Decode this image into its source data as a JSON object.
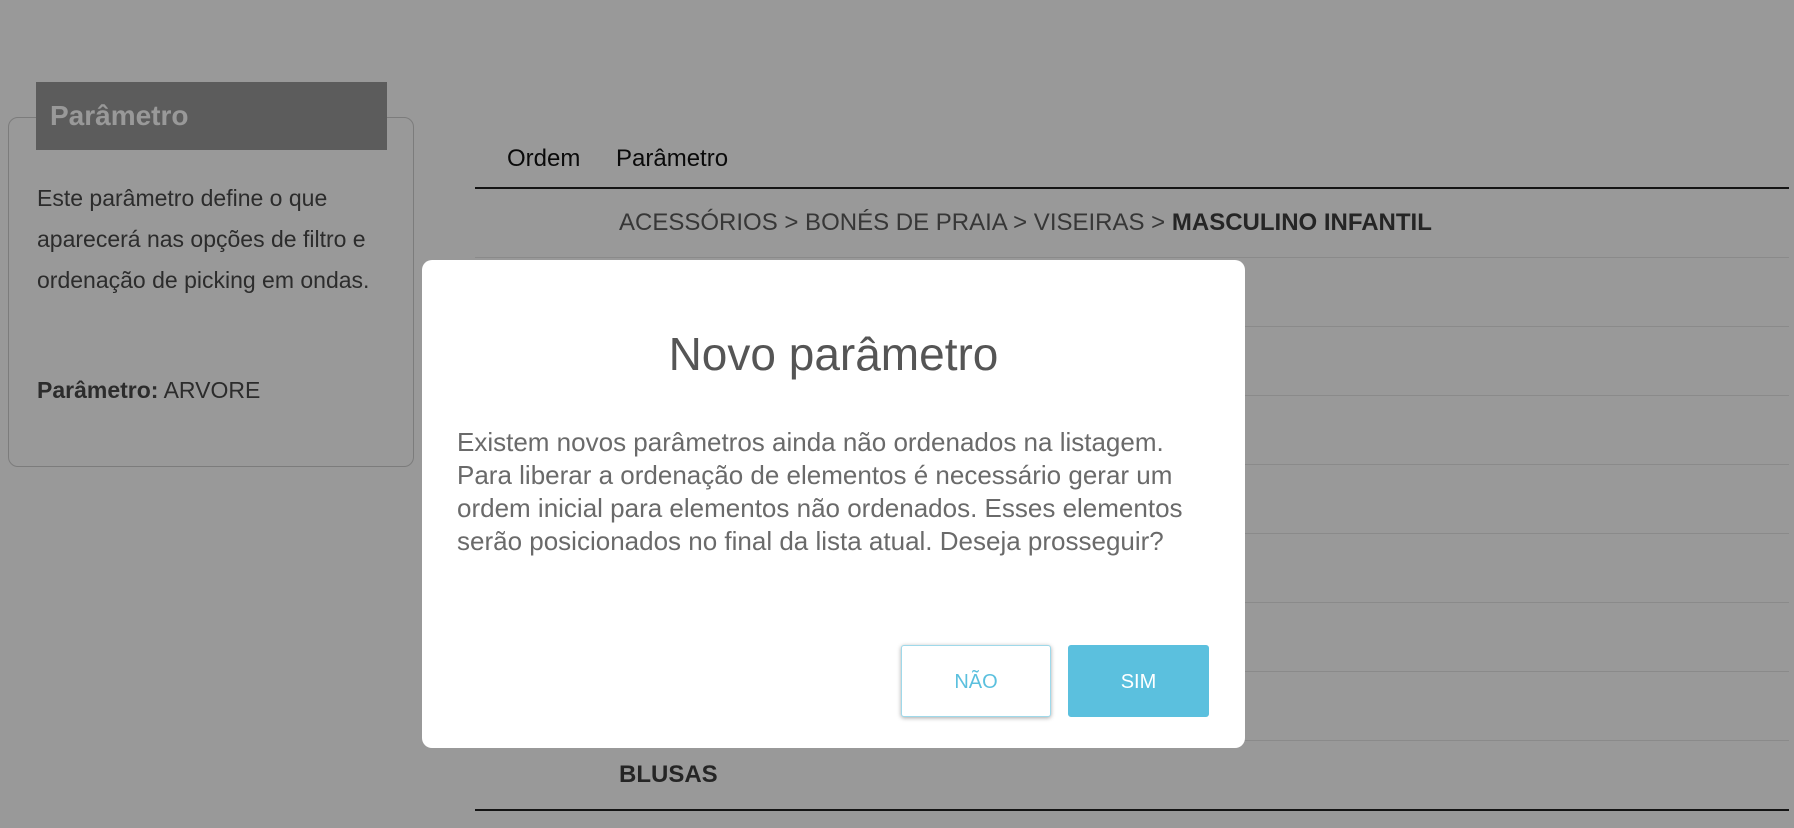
{
  "info_card": {
    "title": "Parâmetro",
    "description": "Este parâmetro define o que aparecerá nas opções de filtro e ordenação de picking em ondas.",
    "param_label": "Parâmetro:",
    "param_value": "ARVORE"
  },
  "table": {
    "headers": {
      "order": "Ordem",
      "parameter": "Parâmetro"
    },
    "rows": [
      {
        "prefix": "ACESSÓRIOS > BONÉS DE PRAIA > VISEIRAS > ",
        "emphasis": "MASCULINO INFANTIL"
      },
      {
        "prefix": "",
        "emphasis": ""
      },
      {
        "prefix": "",
        "emphasis": ""
      },
      {
        "prefix": "",
        "emphasis": ""
      },
      {
        "prefix": "",
        "emphasis": ""
      },
      {
        "prefix": "",
        "emphasis": ""
      },
      {
        "prefix": "",
        "emphasis": ""
      },
      {
        "prefix": "",
        "emphasis": ""
      },
      {
        "prefix": "",
        "emphasis": "BLUSAS"
      }
    ]
  },
  "modal": {
    "title": "Novo parâmetro",
    "message": "Existem novos parâmetros ainda não ordenados na listagem. Para liberar a ordenação de elementos é necessário gerar um ordem inicial para elementos não ordenados. Esses elementos serão posicionados no final da lista atual. Deseja prosseguir?",
    "cancel_label": "NÃO",
    "confirm_label": "SIM"
  },
  "colors": {
    "accent": "#5bc0de",
    "card_header": "#9a9a9a",
    "overlay": "rgba(0,0,0,0.40)"
  }
}
